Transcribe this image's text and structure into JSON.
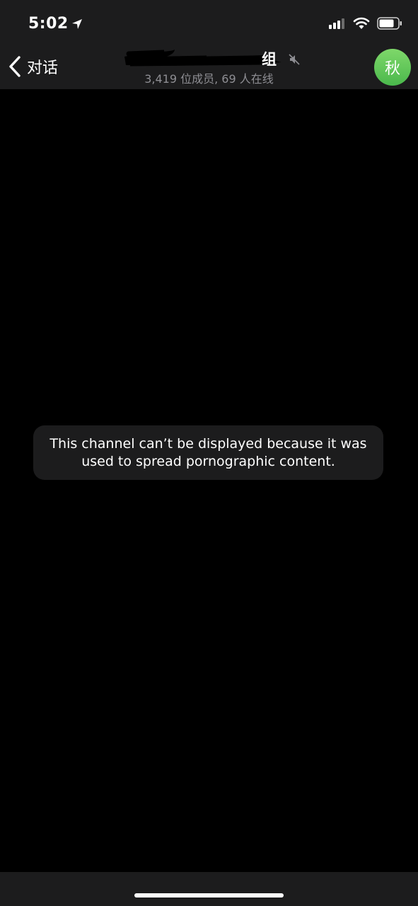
{
  "status_bar": {
    "time": "5:02",
    "icons": [
      "location-arrow-icon",
      "cellular-signal-icon",
      "wifi-icon",
      "battery-icon"
    ]
  },
  "nav": {
    "back_label": "对话",
    "title_tail": "组",
    "subtitle": "3,419 位成员, 69 人在线",
    "avatar_initial": "秋",
    "avatar_color": "#5ec75b"
  },
  "notice": {
    "message": "This channel can’t be displayed because it was used to spread pornographic content."
  }
}
